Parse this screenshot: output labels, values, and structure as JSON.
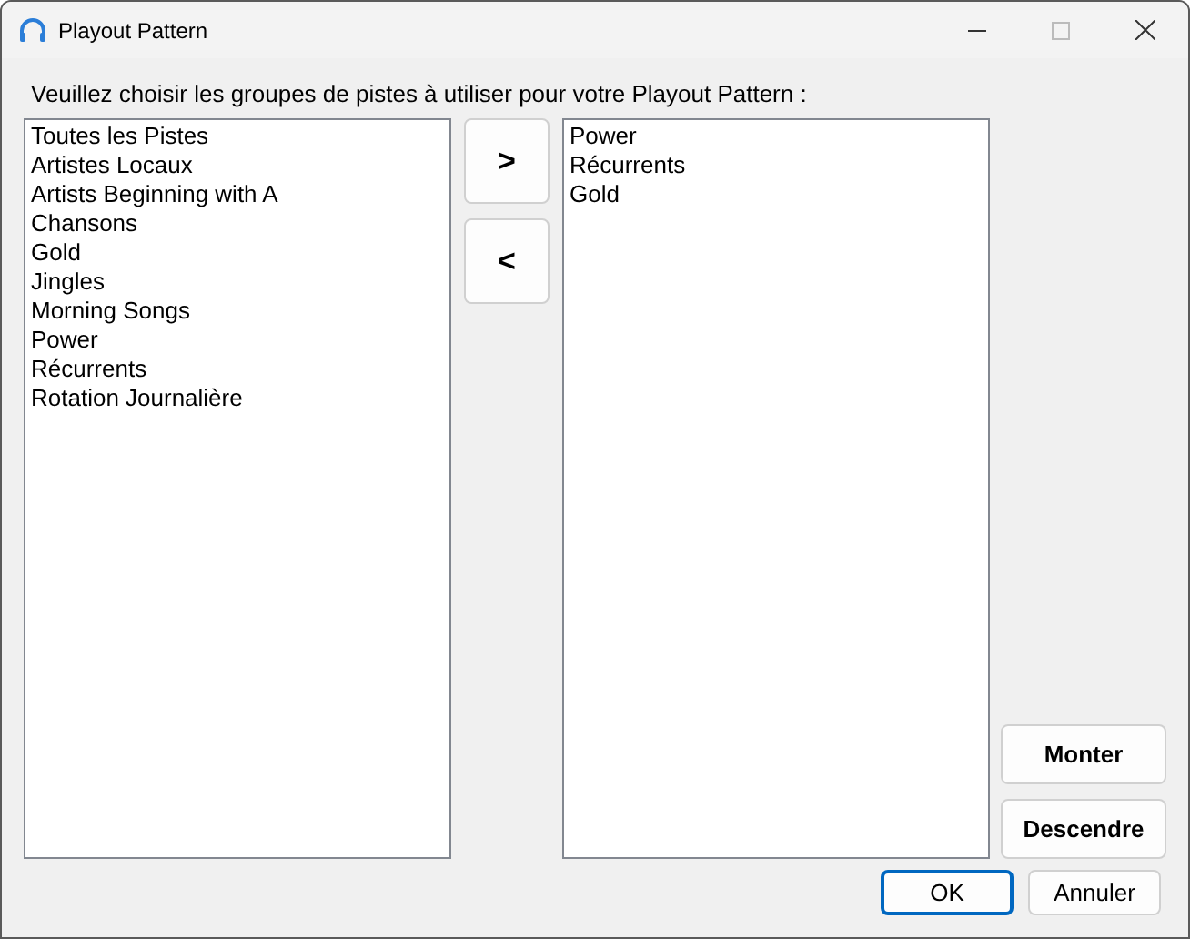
{
  "window": {
    "title": "Playout Pattern"
  },
  "prompt": "Veuillez choisir les groupes de pistes à utiliser pour votre Playout Pattern :",
  "available": [
    "Toutes les Pistes",
    "Artistes Locaux",
    "Artists Beginning with A",
    "Chansons",
    "Gold",
    "Jingles",
    "Morning Songs",
    "Power",
    "Récurrents",
    "Rotation Journalière"
  ],
  "transfer_buttons": [
    ">",
    "<"
  ],
  "selected_groups": [
    "Power",
    "Récurrents",
    "Gold"
  ],
  "order_buttons": [
    "Monter",
    "Descendre"
  ],
  "dialog_buttons": [
    {
      "label": "OK",
      "default": true
    },
    {
      "label": "Annuler",
      "default": false
    }
  ]
}
